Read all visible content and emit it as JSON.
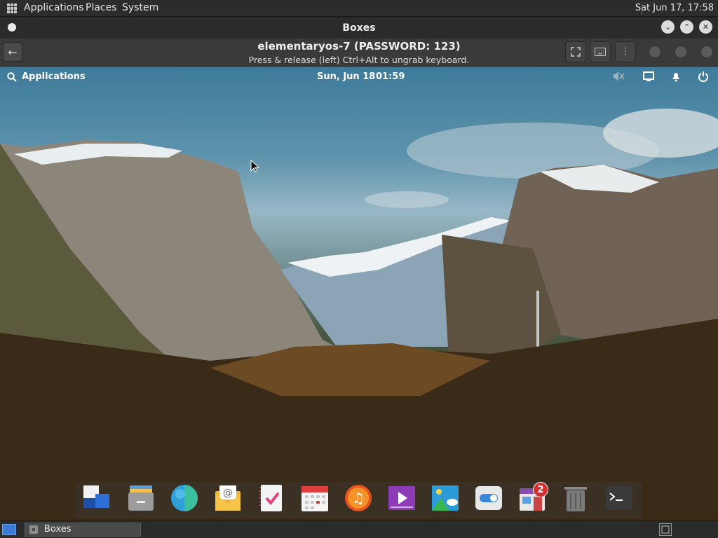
{
  "host_panel": {
    "menus": [
      "Applications",
      "Places",
      "System"
    ],
    "clock": "Sat Jun 17, 17:58"
  },
  "window": {
    "title": "Boxes",
    "vm_title": "elementaryos-7 (PASSWORD: 123)",
    "vm_subtitle": "Press & release (left) Ctrl+Alt to ungrab keyboard."
  },
  "guest": {
    "applications_label": "Applications",
    "date": "Sun, Jun 18",
    "time": "01:59",
    "dock_items": [
      "Multitasking View",
      "Files",
      "Web",
      "Mail",
      "Tasks",
      "Calendar",
      "Music",
      "Videos",
      "Photos",
      "System Settings",
      "AppCenter",
      "Trash",
      "Terminal"
    ],
    "appcenter_badge": "2"
  },
  "host_bottom": {
    "task_label": "Boxes"
  },
  "colors": {
    "panel_bg": "#2c2c2c",
    "headerbar_bg": "#3a3a3a",
    "accent": "#3a7bd5",
    "badge": "#d32f2f"
  }
}
